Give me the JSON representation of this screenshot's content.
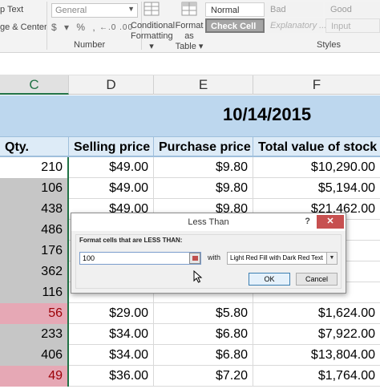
{
  "ribbon": {
    "wrap_text_label": "p Text",
    "merge_center_label": "ge & Center",
    "number_format_value": "General",
    "number_symbols": "$ ▾ % ,",
    "decimal_symbols": "←.0 .00",
    "number_group_label": "Number",
    "conditional_formatting_label": [
      "Conditional",
      "Formatting ▾"
    ],
    "format_as_table_label": [
      "Format as",
      "Table ▾"
    ],
    "styles_group_label": "Styles",
    "styles": {
      "normal": "Normal",
      "bad": "Bad",
      "good": "Good",
      "check_cell": "Check Cell",
      "explanatory": "Explanatory ...",
      "input": "Input"
    }
  },
  "columns": {
    "c": "C",
    "d": "D",
    "e": "E",
    "f": "F"
  },
  "sheet": {
    "date": "10/14/2015",
    "headers": {
      "qty": "Qty.",
      "selling_price": "Selling price",
      "purchase_price": "Purchase price",
      "total_value": "Total value of stock"
    },
    "rows": [
      {
        "qty": "210",
        "sell": "$49.00",
        "buy": "$9.80",
        "total": "$10,290.00"
      },
      {
        "qty": "106",
        "sell": "$49.00",
        "buy": "$9.80",
        "total": "$5,194.00"
      },
      {
        "qty": "438",
        "sell": "$49.00",
        "buy": "$9.80",
        "total": "$21,462.00"
      },
      {
        "qty": "486",
        "sell": "",
        "buy": "",
        "total": ""
      },
      {
        "qty": "176",
        "sell": "",
        "buy": "",
        "total": ""
      },
      {
        "qty": "362",
        "sell": "",
        "buy": "",
        "total": ""
      },
      {
        "qty": "116",
        "sell": "",
        "buy": "",
        "total": ""
      },
      {
        "qty": "56",
        "sell": "$29.00",
        "buy": "$5.80",
        "total": "$1,624.00"
      },
      {
        "qty": "233",
        "sell": "$34.00",
        "buy": "$6.80",
        "total": "$7,922.00"
      },
      {
        "qty": "406",
        "sell": "$34.00",
        "buy": "$6.80",
        "total": "$13,804.00"
      },
      {
        "qty": "49",
        "sell": "$36.00",
        "buy": "$7.20",
        "total": "$1,764.00"
      }
    ]
  },
  "dialog": {
    "title": "Less Than",
    "help": "?",
    "close": "✕",
    "prompt": "Format cells that are LESS THAN:",
    "value": "100",
    "with_label": "with",
    "format_option": "Light Red Fill with Dark Red Text",
    "ok_label": "OK",
    "cancel_label": "Cancel"
  },
  "colors": {
    "highlight_fill": "#e6a8b5",
    "highlight_text": "#9c0006",
    "header_band": "#bdd7ee",
    "excel_green": "#217346"
  }
}
